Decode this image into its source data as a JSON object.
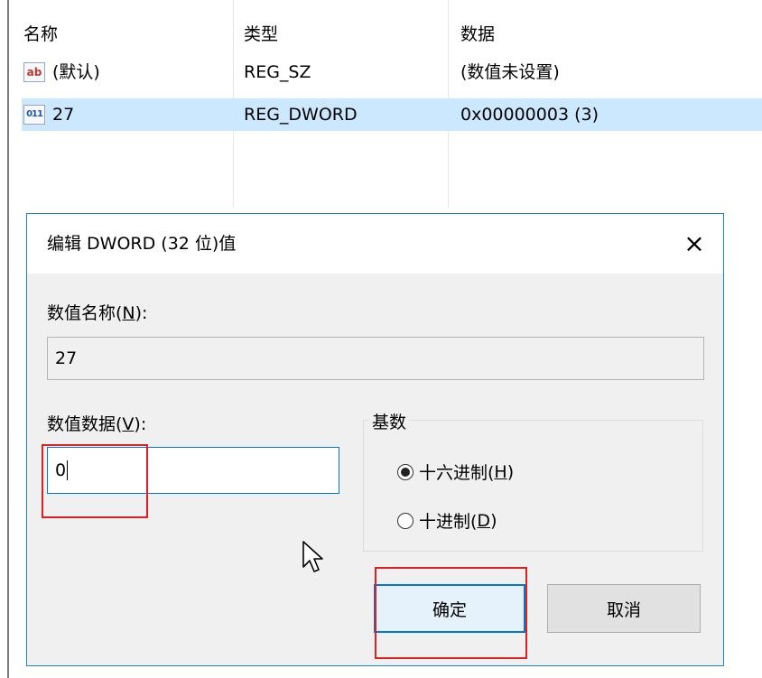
{
  "registry_list": {
    "headers": {
      "name": "名称",
      "type": "类型",
      "data": "数据"
    },
    "rows": [
      {
        "icon": "string-value-icon",
        "icon_text": "ab",
        "name": "(默认)",
        "type": "REG_SZ",
        "data": "(数值未设置)",
        "selected": false
      },
      {
        "icon": "binary-value-icon",
        "icon_text": "011",
        "name": "27",
        "type": "REG_DWORD",
        "data": "0x00000003 (3)",
        "selected": true
      }
    ]
  },
  "dialog": {
    "title": "编辑 DWORD (32 位)值",
    "close_icon": "×",
    "value_name_label": "数值名称(",
    "value_name_mnemonic": "N",
    "value_name_label_end": "):",
    "value_name": "27",
    "value_data_label": "数值数据(",
    "value_data_mnemonic": "V",
    "value_data_label_end": "):",
    "value_data": "0",
    "base_group_label": "基数",
    "radio_hex_label": "十六进制(",
    "radio_hex_mnemonic": "H",
    "radio_hex_label_end": ")",
    "radio_hex_checked": true,
    "radio_dec_label": "十进制(",
    "radio_dec_mnemonic": "D",
    "radio_dec_label_end": ")",
    "radio_dec_checked": false,
    "ok_label": "确定",
    "cancel_label": "取消"
  },
  "colors": {
    "selection": "#cce8ff",
    "accent": "#0078d7",
    "highlight_box": "#e02020"
  }
}
